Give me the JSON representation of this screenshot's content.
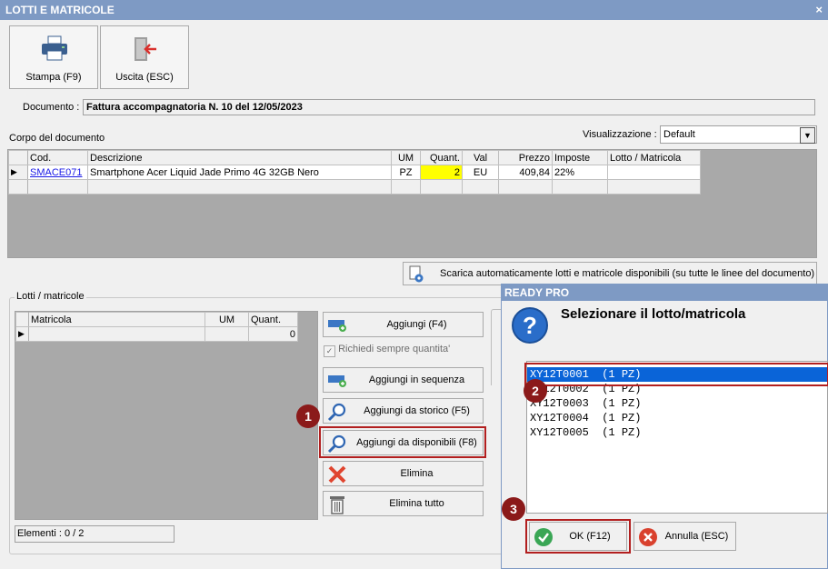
{
  "window": {
    "title": "LOTTI E MATRICOLE",
    "close": "×"
  },
  "toolbar": {
    "print_label": "Stampa (F9)",
    "exit_label": "Uscita (ESC)"
  },
  "document": {
    "label": "Documento :",
    "value": "Fattura accompagnatoria N. 10 del 12/05/2023"
  },
  "body_section": {
    "label": "Corpo del documento"
  },
  "visualization": {
    "label": "Visualizzazione :",
    "value": "Default"
  },
  "lines_table": {
    "headers": [
      "Cod.",
      "Descrizione",
      "UM",
      "Quant.",
      "Val",
      "Prezzo",
      "Imposte",
      "Lotto / Matricola"
    ],
    "row": {
      "cod": "SMACE071",
      "desc": "Smartphone Acer Liquid Jade Primo 4G 32GB Nero",
      "um": "PZ",
      "qty": "2",
      "val": "EU",
      "price": "409,84",
      "tax": "22%",
      "lot": ""
    },
    "highlight_color": "#ffff00"
  },
  "auto_download": {
    "label": "Scarica automaticamente lotti e matricole disponibili (su tutte le linee del documento)"
  },
  "lots_section": {
    "label": "Lotti / matricole",
    "headers": [
      "Matricola",
      "UM",
      "Quant."
    ],
    "row": {
      "matricola": "",
      "um": "",
      "qty": "0"
    },
    "elements": "Elementi : 0 / 2"
  },
  "actions": {
    "add": "Aggiungi (F4)",
    "always_ask_qty": "Richiedi sempre quantita'",
    "add_sequence": "Aggiungi in sequenza",
    "add_history": "Aggiungi da storico (F5)",
    "add_available": "Aggiungi da disponibili (F8)",
    "delete": "Elimina",
    "delete_all": "Elimina tutto"
  },
  "dialog": {
    "title": "READY PRO",
    "heading": "Selezionare il lotto/matricola",
    "items": [
      "XY12T0001  (1 PZ)",
      "XY12T0002  (1 PZ)",
      "XY12T0003  (1 PZ)",
      "XY12T0004  (1 PZ)",
      "XY12T0005  (1 PZ)"
    ],
    "ok": "OK (F12)",
    "cancel": "Annulla (ESC)"
  },
  "badges": {
    "one": "1",
    "two": "2",
    "three": "3"
  },
  "colors": {
    "title_bar": "#7e9ac4",
    "selection": "#0a64d8",
    "callout_red": "#b21f1f"
  }
}
